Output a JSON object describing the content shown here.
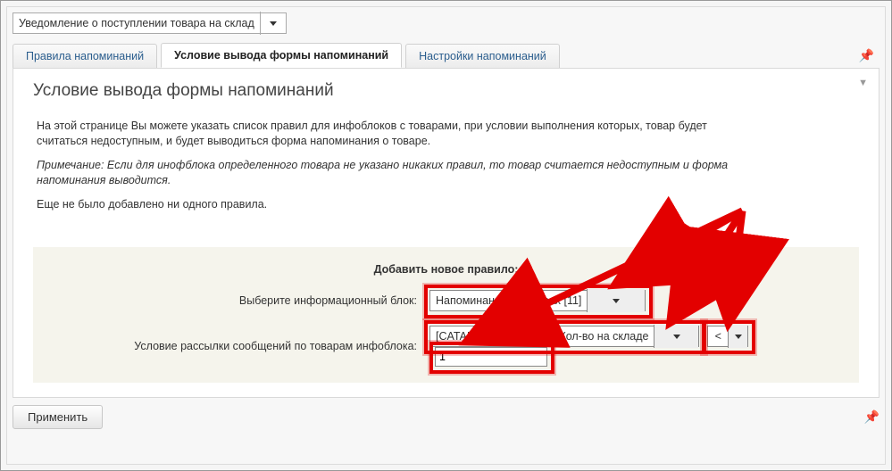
{
  "topSelect": {
    "value": "Уведомление о поступлении товара на склад"
  },
  "tabs": {
    "rules": "Правила напоминаний",
    "condition": "Условие вывода формы напоминаний",
    "settings": "Настройки напоминаний"
  },
  "panel": {
    "title": "Условие вывода формы напоминаний",
    "desc1": "На этой странице Вы можете указать список правил для инфоблоков с товарами, при условии выполнения которых, товар будет считаться недоступным, и будет выводиться форма напоминания о товаре.",
    "desc2": "Примечание: Если для инофблока определенного товара не указано никаких правил, то товар считается недоступным и форма напоминания выводится.",
    "desc3": "Еще не было добавлено ни одного правила."
  },
  "rule": {
    "addHeading": "Добавить новое правило:",
    "labelIblock": "Выберите информационный блок:",
    "labelCond": "Условие рассылки сообщений по товарам инфоблока:",
    "iblockValue": "Напоминание о товарах [11]",
    "propValue": "[CATALOG_QUANTITY] Кол-во на складе",
    "opValue": "<",
    "numValue": "1"
  },
  "buttons": {
    "apply": "Применить"
  }
}
